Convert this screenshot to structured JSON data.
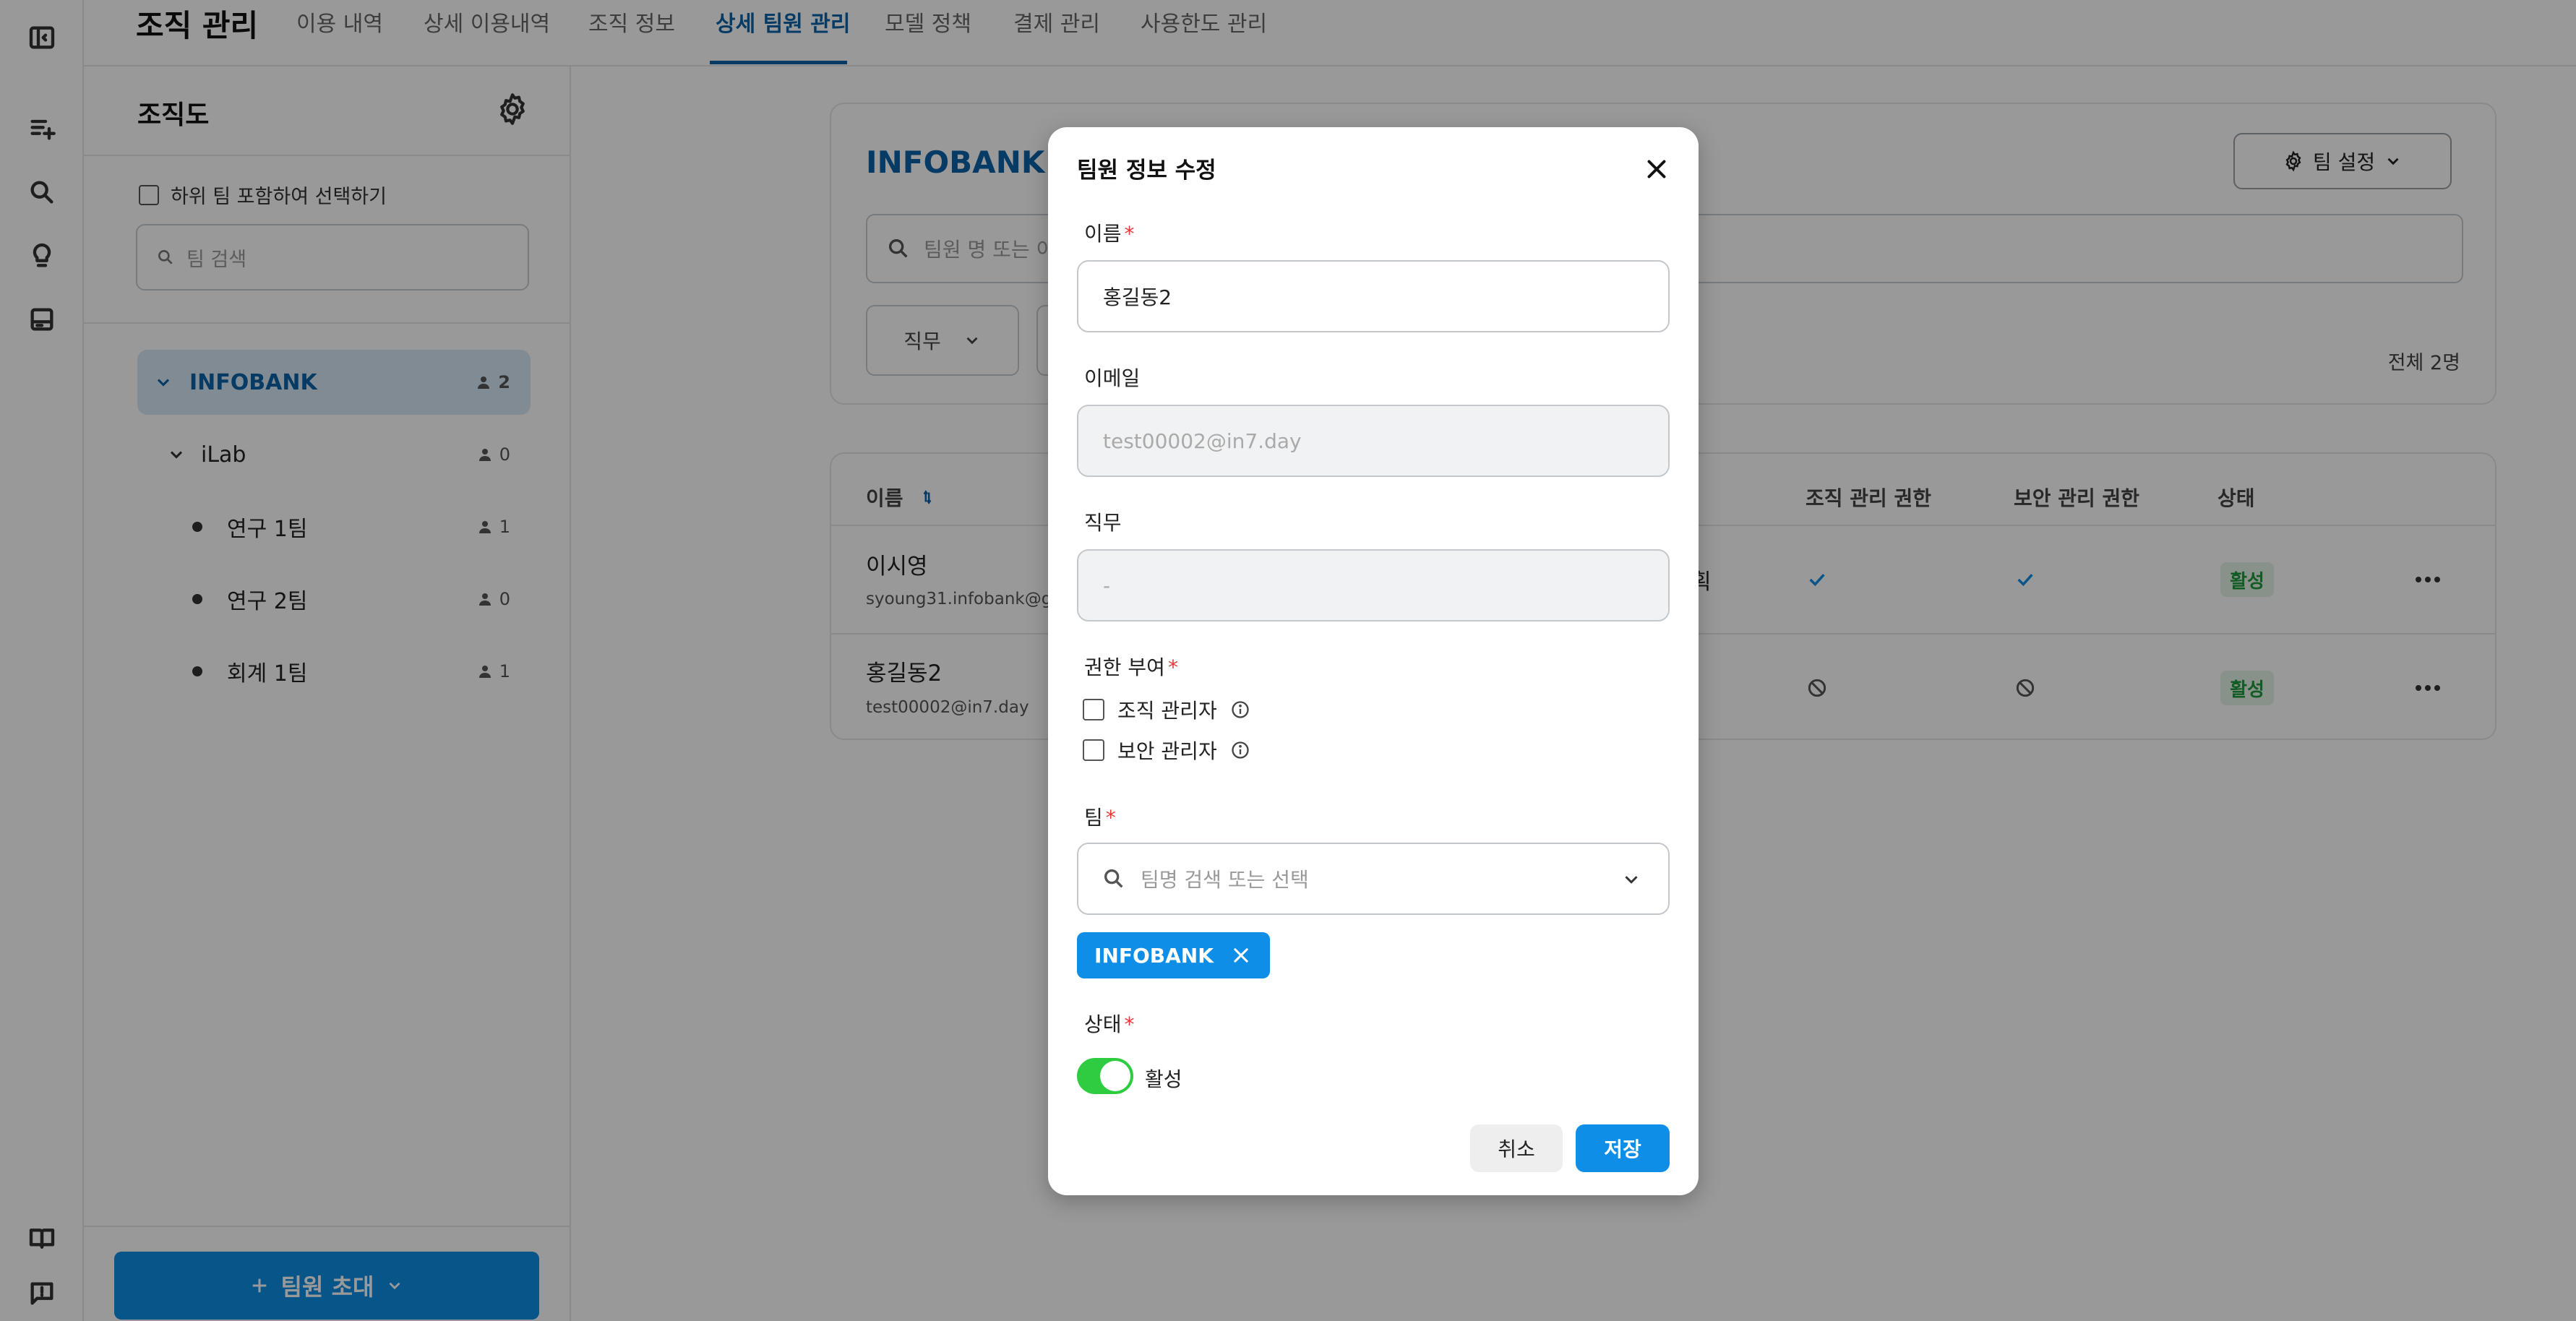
{
  "header": {
    "title": "조직 관리",
    "tabs": [
      {
        "label": "이용 내역"
      },
      {
        "label": "상세 이용내역"
      },
      {
        "label": "조직 정보"
      },
      {
        "label": "상세 팀원 관리"
      },
      {
        "label": "모델 정책"
      },
      {
        "label": "결제 관리"
      },
      {
        "label": "사용한도 관리"
      }
    ],
    "active_tab": "상세 팀원 관리"
  },
  "rail": {
    "icons": [
      "sidebar-toggle-icon",
      "new-chat-icon",
      "search-icon",
      "lightbulb-icon",
      "layout-icon",
      "book-icon",
      "feedback-icon"
    ]
  },
  "org": {
    "title": "조직도",
    "include_sub_label": "하위 팀 포함하여 선택하기",
    "search_placeholder": "팀 검색",
    "tree": [
      {
        "label": "INFOBANK",
        "count": "2"
      },
      {
        "label": "iLab",
        "count": "0"
      },
      {
        "label": "연구 1팀",
        "count": "1"
      },
      {
        "label": "연구 2팀",
        "count": "0"
      },
      {
        "label": "회계 1팀",
        "count": "1"
      }
    ],
    "invite_label": "팀원 초대"
  },
  "main": {
    "company": "INFOBANK",
    "team_setting_label": "팀 설정",
    "search_placeholder": "팀원 명 또는 이",
    "filter_label": "직무",
    "total": "전체 2명",
    "columns": {
      "name": "이름",
      "org_admin": "조직 관리 권한",
      "sec_admin": "보안 관리 권한",
      "status": "상태"
    },
    "rows": [
      {
        "name": "이시영",
        "email": "syoung31.infobank@gm",
        "job_tail": "획",
        "status": "활성"
      },
      {
        "name": "홍길동2",
        "email": "test00002@in7.day",
        "status": "활성"
      }
    ]
  },
  "modal": {
    "title": "팀원 정보 수정",
    "name_label": "이름",
    "name_value": "홍길동2",
    "email_label": "이메일",
    "email_value": "test00002@in7.day",
    "job_label": "직무",
    "job_value": "-",
    "perm_label": "권한 부여",
    "perm_org": "조직 관리자",
    "perm_sec": "보안 관리자",
    "team_label": "팀",
    "team_placeholder": "팀명 검색 또는 선택",
    "team_chip": "INFOBANK",
    "status_label": "상태",
    "status_value": "활성",
    "cancel_label": "취소",
    "save_label": "저장",
    "required_mark": "*"
  },
  "colors": {
    "accent": "#0e8ee6",
    "brand_text": "#0b63a8",
    "active_green": "#2ecc40",
    "required": "#e53935"
  }
}
